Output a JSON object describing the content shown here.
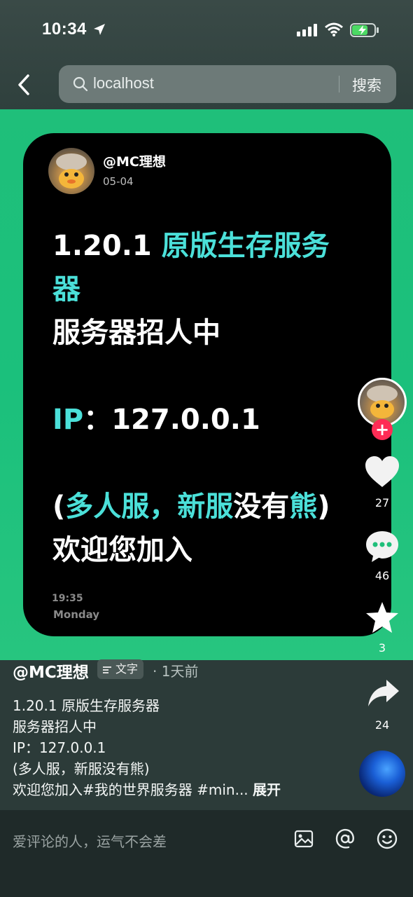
{
  "status_bar": {
    "time": "10:34"
  },
  "search": {
    "query": "localhost",
    "button_label": "搜索"
  },
  "card": {
    "author": "@MC理想",
    "date": "05-04",
    "line1_white": "1.20.1 ",
    "line1_cyan": "原版生存服务",
    "line2_cyan": "器",
    "line3": "服务器招人中",
    "line4_cyan": "IP",
    "line4_white": "：127.0.0.1",
    "line5_a": "(",
    "line5_b": "多人服，",
    "line5_c": "新服",
    "line5_d": "没有",
    "line5_e": "熊",
    "line5_f": ")",
    "line6": "欢迎您加入",
    "clock_time": "19:35",
    "clock_day": "Monday"
  },
  "actions": {
    "likes": "27",
    "comments": "46",
    "favorites": "3",
    "shares": "24"
  },
  "info": {
    "author": "@MC理想",
    "tag": "文字",
    "time": "· 1天前",
    "desc": [
      "1.20.1 原版生存服务器",
      "服务器招人中",
      "IP：127.0.0.1",
      "(多人服，新服没有熊)"
    ],
    "desc_last": "欢迎您加入#我的世界服务器 #min...",
    "expand": "展开"
  },
  "comment_bar": {
    "placeholder": "爱评论的人，运气不会差"
  },
  "colors": {
    "accent_green": "#1fbf7a",
    "cyan_text": "#4be0d9",
    "follow_red": "#fe2c55"
  }
}
